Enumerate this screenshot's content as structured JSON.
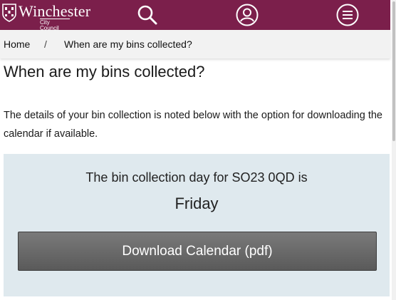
{
  "header": {
    "logo": {
      "name": "Winchester",
      "subtitle": "City Council"
    },
    "icons": {
      "search": "search-icon",
      "account": "account-icon",
      "menu": "menu-icon"
    },
    "brand_color": "#7b1f4b"
  },
  "breadcrumb": {
    "home": "Home",
    "separator": "/",
    "current": "When are my bins collected?"
  },
  "main": {
    "title": "When are my bins collected?",
    "intro": "The details of your bin collection is noted below with the option for downloading the calendar if available.",
    "result": {
      "lead": "The bin collection day for SO23 0QD is",
      "day": "Friday",
      "download_label": "Download Calendar (pdf)"
    },
    "panel_color": "#dfe9ee"
  }
}
